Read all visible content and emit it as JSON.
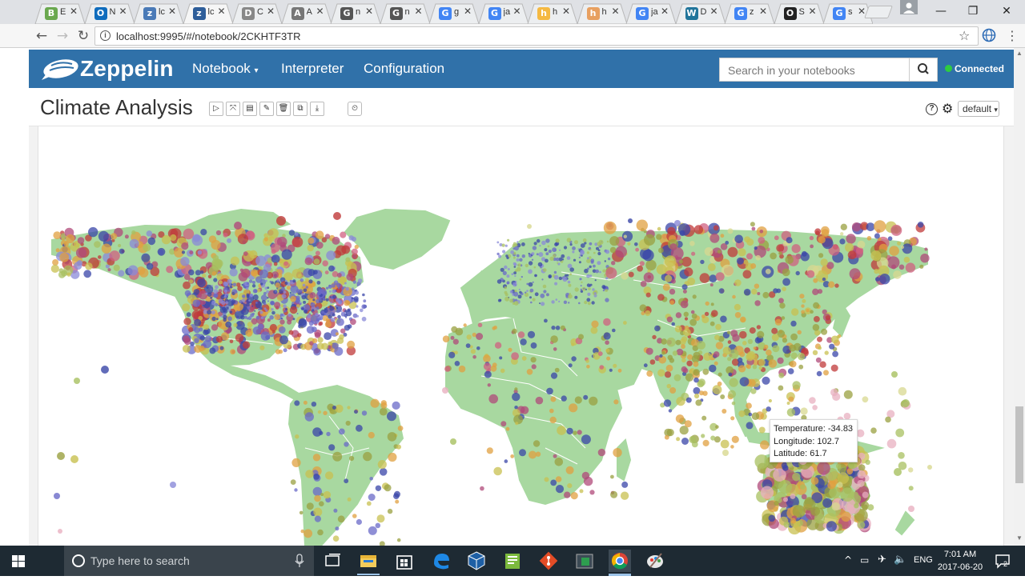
{
  "browser": {
    "tabs": [
      {
        "fav": "B",
        "color": "#6aa84f",
        "title": "E"
      },
      {
        "fav": "O",
        "color": "#0f6cbd",
        "title": "N"
      },
      {
        "fav": "z",
        "color": "#4a7ab7",
        "title": "lc"
      },
      {
        "fav": "z",
        "color": "#2e5e9a",
        "title": "lc"
      },
      {
        "fav": "D",
        "color": "#888888",
        "title": "C"
      },
      {
        "fav": "A",
        "color": "#777777",
        "title": "A"
      },
      {
        "fav": "G",
        "color": "#555555",
        "title": "n"
      },
      {
        "fav": "G",
        "color": "#555555",
        "title": "n"
      },
      {
        "fav": "G",
        "color": "#4285f4",
        "title": "g"
      },
      {
        "fav": "G",
        "color": "#4285f4",
        "title": "ja"
      },
      {
        "fav": "h",
        "color": "#f5b942",
        "title": "h"
      },
      {
        "fav": "h",
        "color": "#e8a060",
        "title": "h"
      },
      {
        "fav": "G",
        "color": "#4285f4",
        "title": "ja"
      },
      {
        "fav": "W",
        "color": "#21759b",
        "title": "D"
      },
      {
        "fav": "G",
        "color": "#4285f4",
        "title": "z"
      },
      {
        "fav": "O",
        "color": "#222222",
        "title": "S"
      },
      {
        "fav": "G",
        "color": "#4285f4",
        "title": "s"
      }
    ],
    "close_glyph": "✕",
    "url": "localhost:9995/#/notebook/2CKHTF3TR",
    "window": {
      "minimize": "—",
      "maximize": "❐",
      "close": "✕"
    }
  },
  "zeppelin": {
    "brand": "Zeppelin",
    "menu": {
      "notebook": "Notebook",
      "interpreter": "Interpreter",
      "configuration": "Configuration"
    },
    "search_placeholder": "Search in your notebooks",
    "status": "Connected"
  },
  "notebook": {
    "title": "Climate Analysis",
    "toolbar": [
      "▷",
      "⤧",
      "▤",
      "✎",
      "🗑",
      "⧉",
      "⤓"
    ],
    "scheduler": "⏲",
    "interpreter_binding": "default"
  },
  "tooltip": {
    "temperature_line": "Temperature: -34.83",
    "longitude_line": "Longitude: 102.7",
    "latitude_line": "Latitude: 61.7"
  },
  "colors": {
    "land": "#a8d8a0",
    "nav": "#3071a9",
    "points": [
      "#3a46a8",
      "#6a6ac8",
      "#8a8ad8",
      "#b04a7a",
      "#c03a3a",
      "#d06080",
      "#e0a040",
      "#c8c050",
      "#a8c060",
      "#9aa040",
      "#d8d890",
      "#e8b0c0"
    ]
  },
  "taskbar": {
    "search_placeholder": "Type here to search",
    "language": "ENG",
    "time": "7:01 AM",
    "date": "2017-06-20"
  }
}
